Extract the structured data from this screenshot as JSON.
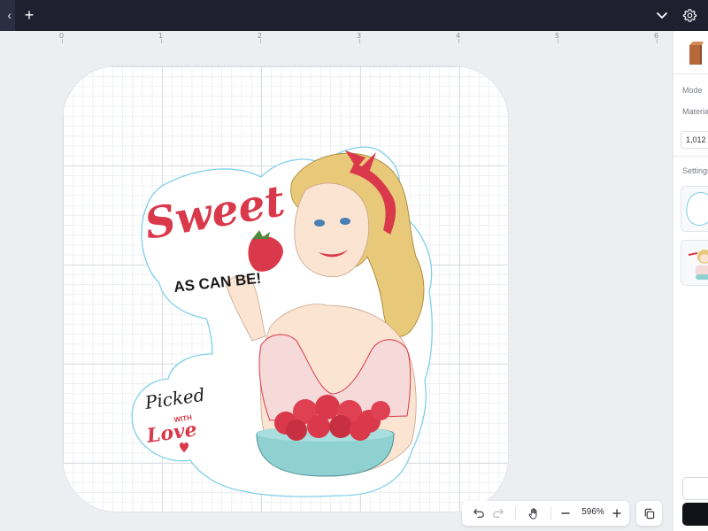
{
  "topbar": {
    "back_glyph": "‹",
    "add_tab_glyph": "+",
    "icons": [
      "chevron-left-icon",
      "plus-icon",
      "chevron-down-icon",
      "gear-icon"
    ]
  },
  "ruler": {
    "labels": [
      "0",
      "1",
      "2",
      "3",
      "4",
      "5",
      "6"
    ]
  },
  "sticker": {
    "headline": "Sweet",
    "tagline": "AS CAN BE!",
    "badge_line1": "Picked",
    "badge_line2": "WITH",
    "badge_line3": "Love",
    "colors": {
      "red": "#d9394a",
      "outline": "#7fd0e8",
      "ink": "#1a1a1a"
    }
  },
  "zoom_toolbar": {
    "zoom": "596%",
    "icons": [
      "undo-icon",
      "redo-icon",
      "hand-icon",
      "zoom-out-icon",
      "zoom-in-icon",
      "duplicate-icon"
    ]
  },
  "right_panel": {
    "mode_label": "Mode",
    "material_label": "Materia",
    "size_value": "1,012",
    "settings_label": "Settings"
  }
}
